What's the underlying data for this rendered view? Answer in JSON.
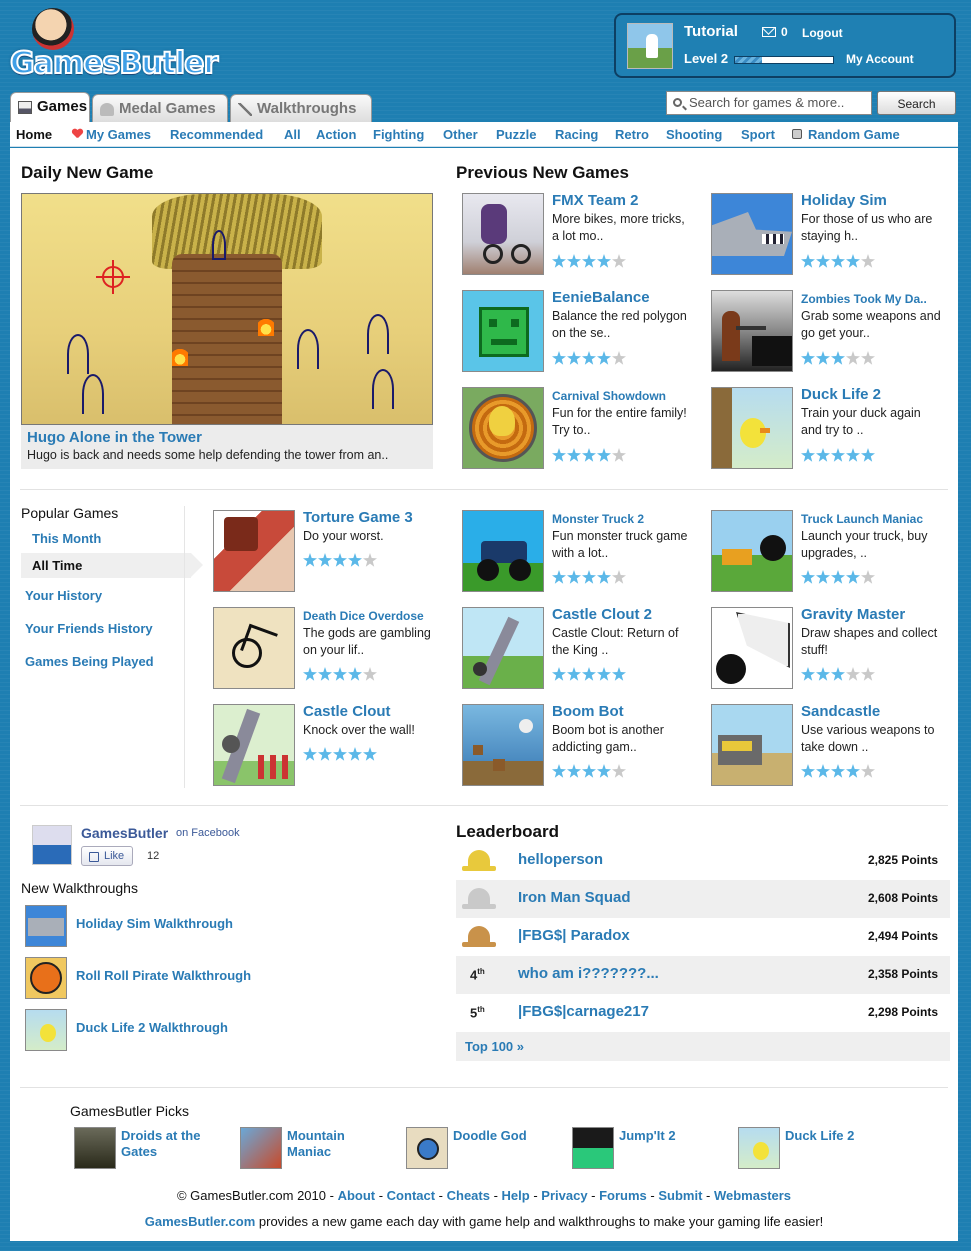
{
  "header": {
    "logo_text": "GamesButler",
    "user": {
      "name": "Tutorial",
      "messages": "0",
      "logout": "Logout",
      "level": "Level 2",
      "level_progress": 0.28,
      "account": "My Account"
    }
  },
  "tabs": [
    {
      "label": "Games"
    },
    {
      "label": "Medal Games"
    },
    {
      "label": "Walkthroughs"
    }
  ],
  "search": {
    "placeholder": "Search for games & more..",
    "button": "Search"
  },
  "nav": [
    "Home",
    "My Games",
    "Recommended",
    "All",
    "Action",
    "Fighting",
    "Other",
    "Puzzle",
    "Racing",
    "Retro",
    "Shooting",
    "Sport",
    "Random Game"
  ],
  "daily": {
    "heading": "Daily New Game",
    "title": "Hugo Alone in the Tower",
    "desc": "Hugo is back and needs some help defending the tower from an.."
  },
  "previous": {
    "heading": "Previous New Games",
    "games": [
      {
        "title": "FMX Team 2",
        "desc": "More bikes, more tricks, a lot mo..",
        "rating": 4
      },
      {
        "title": "Holiday Sim",
        "desc": "For those of us who are staying h..",
        "rating": 4
      },
      {
        "title": "EenieBalance",
        "desc": "Balance the red polygon on the se..",
        "rating": 4
      },
      {
        "title": "Zombies Took My Da..",
        "desc": "Grab some weapons and go get your..",
        "rating": 3
      },
      {
        "title": "Carnival Showdown",
        "desc": "Fun for the entire family! Try to..",
        "rating": 4
      },
      {
        "title": "Duck Life 2",
        "desc": "Train your duck again and try to ..",
        "rating": 5
      }
    ]
  },
  "popular": {
    "heading": "Popular Games",
    "filters": [
      "This Month",
      "All Time",
      "Your History",
      "Your Friends History",
      "Games Being Played"
    ],
    "games": [
      {
        "title": "Torture Game 3",
        "desc": "Do your worst.",
        "rating": 4
      },
      {
        "title": "Monster Truck 2",
        "desc": "Fun monster truck game with a lot..",
        "rating": 4
      },
      {
        "title": "Truck Launch Maniac",
        "desc": "Launch your truck, buy upgrades, ..",
        "rating": 4
      },
      {
        "title": "Death Dice Overdose",
        "desc": "The gods are gambling on your lif..",
        "rating": 4
      },
      {
        "title": "Castle Clout 2",
        "desc": "Castle Clout: Return of the King ..",
        "rating": 5
      },
      {
        "title": "Gravity Master",
        "desc": "Draw shapes and collect stuff!",
        "rating": 3
      },
      {
        "title": "Castle Clout",
        "desc": "Knock over the wall!",
        "rating": 5
      },
      {
        "title": "Boom Bot",
        "desc": "Boom bot is another addicting gam..",
        "rating": 4
      },
      {
        "title": "Sandcastle",
        "desc": "Use various weapons to take down ..",
        "rating": 4
      }
    ]
  },
  "facebook": {
    "name": "GamesButler",
    "on": "on Facebook",
    "like": "Like",
    "count": "12"
  },
  "walkthroughs": {
    "heading": "New Walkthroughs",
    "items": [
      "Holiday Sim Walkthrough",
      "Roll Roll Pirate Walkthrough",
      "Duck Life 2 Walkthrough"
    ]
  },
  "leaderboard": {
    "heading": "Leaderboard",
    "rows": [
      {
        "medal": "1st",
        "name": "helloperson",
        "points": "2,825 Points"
      },
      {
        "medal": "2nd",
        "name": "Iron Man Squad",
        "points": "2,608 Points"
      },
      {
        "medal": "3rd",
        "name": "|FBG$| Paradox",
        "points": "2,494 Points"
      },
      {
        "rank": "4",
        "suffix": "th",
        "name": "who am i???????...",
        "points": "2,358 Points"
      },
      {
        "rank": "5",
        "suffix": "th",
        "name": "|FBG$|carnage217",
        "points": "2,298 Points"
      }
    ],
    "more": "Top 100 »"
  },
  "picks": {
    "heading": "GamesButler Picks",
    "items": [
      "Droids at the Gates",
      "Mountain Maniac",
      "Doodle God",
      "Jump'It 2",
      "Duck Life 2"
    ]
  },
  "footer": {
    "copyright": "© GamesButler.com 2010 -",
    "links": [
      "About",
      "Contact",
      "Cheats",
      "Help",
      "Privacy",
      "Forums",
      "Submit",
      "Webmasters"
    ],
    "site": "GamesButler.com",
    "tagline": " provides a new game each day with game help and walkthroughs to make your gaming life easier!"
  }
}
